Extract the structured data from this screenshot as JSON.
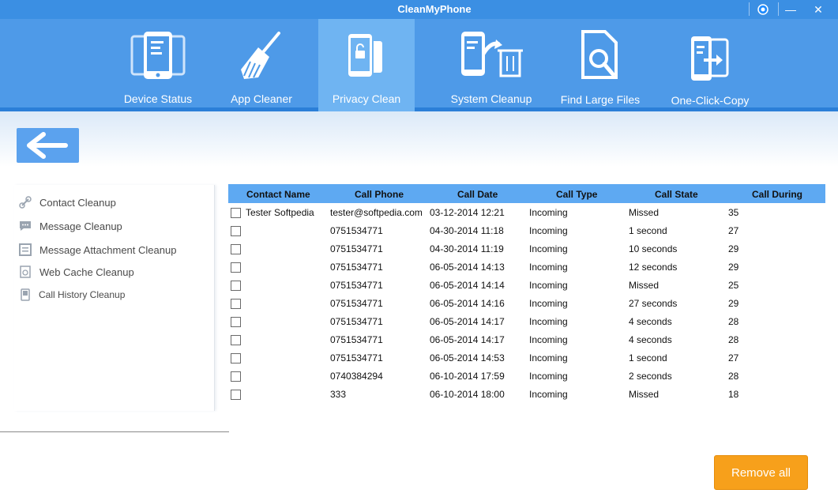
{
  "window": {
    "title": "CleanMyPhone",
    "minimize_glyph": "—",
    "close_glyph": "✕",
    "settings_icon": "gear-icon"
  },
  "toolbar": {
    "items": [
      {
        "label": "Device Status",
        "icon": "phones-icon",
        "active": false
      },
      {
        "label": "App Cleaner",
        "icon": "broom-icon",
        "active": false
      },
      {
        "label": "Privacy Clean",
        "icon": "privacy-phone-icon",
        "active": true
      },
      {
        "label": "System Cleanup",
        "icon": "phone-trash-icon",
        "active": false
      },
      {
        "label": "Find Large Files",
        "icon": "file-search-icon",
        "active": false
      },
      {
        "label": "One-Click-Copy",
        "icon": "phone-copy-icon",
        "active": false
      }
    ]
  },
  "back_button": {
    "icon": "arrow-left-icon"
  },
  "sidebar": {
    "items": [
      {
        "label": "Contact Cleanup",
        "icon": "link-icon"
      },
      {
        "label": "Message Cleanup",
        "icon": "chat-icon"
      },
      {
        "label": "Message Attachment Cleanup",
        "icon": "attachment-icon"
      },
      {
        "label": "Web Cache Cleanup",
        "icon": "web-cache-icon"
      },
      {
        "label": "Call History Cleanup",
        "icon": "call-history-icon"
      }
    ]
  },
  "table": {
    "columns": [
      "Contact Name",
      "Call Phone",
      "Call Date",
      "Call Type",
      "Call State",
      "Call During"
    ],
    "rows": [
      [
        "Tester Softpedia",
        "tester@softpedia.com",
        "03-12-2014 12:21",
        "Incoming",
        "Missed",
        "35"
      ],
      [
        "",
        "0751534771",
        "04-30-2014 11:18",
        "Incoming",
        "1 second",
        "27"
      ],
      [
        "",
        "0751534771",
        "04-30-2014 11:19",
        "Incoming",
        "10 seconds",
        "29"
      ],
      [
        "",
        "0751534771",
        "06-05-2014 14:13",
        "Incoming",
        "12 seconds",
        "29"
      ],
      [
        "",
        "0751534771",
        "06-05-2014 14:14",
        "Incoming",
        "Missed",
        "25"
      ],
      [
        "",
        "0751534771",
        "06-05-2014 14:16",
        "Incoming",
        "27 seconds",
        "29"
      ],
      [
        "",
        "0751534771",
        "06-05-2014 14:17",
        "Incoming",
        "4 seconds",
        "28"
      ],
      [
        "",
        "0751534771",
        "06-05-2014 14:17",
        "Incoming",
        "4 seconds",
        "28"
      ],
      [
        "",
        "0751534771",
        "06-05-2014 14:53",
        "Incoming",
        "1 second",
        "27"
      ],
      [
        "",
        "0740384294",
        "06-10-2014 17:59",
        "Incoming",
        "2 seconds",
        "28"
      ],
      [
        "",
        "333",
        "06-10-2014 18:00",
        "Incoming",
        "Missed",
        "18"
      ]
    ]
  },
  "remove_all_label": "Remove all",
  "colors": {
    "titlebar": "#3b8fe3",
    "toolbar": "#4e9ae8",
    "active_tab": "#6fb4f2",
    "table_header": "#5ea9f2",
    "accent_button": "#f7a01b"
  }
}
